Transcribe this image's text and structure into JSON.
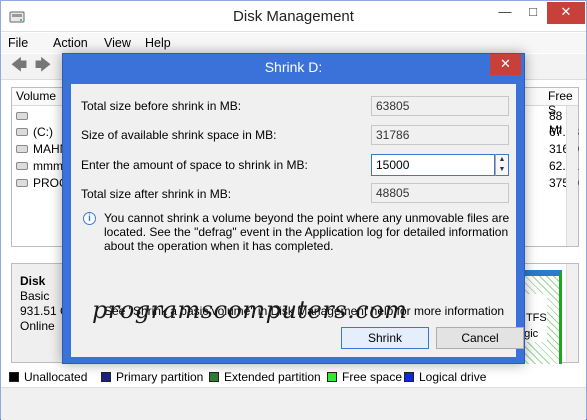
{
  "window": {
    "title": "Disk Management"
  },
  "menu": [
    "File",
    "Action",
    "View",
    "Help"
  ],
  "volume_list": {
    "columns": {
      "volume": "Volume",
      "free": "Free S"
    },
    "rows": [
      {
        "name": "",
        "free": "88 MI"
      },
      {
        "name": "(C:)",
        "free": "67.93"
      },
      {
        "name": "MAHN",
        "free": "316.0"
      },
      {
        "name": "mmm",
        "free": "62.21"
      },
      {
        "name": "PROG",
        "free": "375.0"
      }
    ]
  },
  "disk": {
    "name": "Disk",
    "type": "Basic",
    "size": "931.51 G",
    "status": "Online",
    "bar_lines": [
      ":)",
      "NTFS",
      "ogic"
    ]
  },
  "legend": [
    {
      "label": "Unallocated",
      "color": "#000000"
    },
    {
      "label": "Primary partition",
      "color": "#1a237e"
    },
    {
      "label": "Extended partition",
      "color": "#2e7d32"
    },
    {
      "label": "Free space",
      "color": "#39e639"
    },
    {
      "label": "Logical drive",
      "color": "#0b2bdc"
    }
  ],
  "dialog": {
    "title": "Shrink D:",
    "fields": [
      {
        "label": "Total size before shrink in MB:",
        "value": "63805"
      },
      {
        "label": "Size of available shrink space in MB:",
        "value": "31786"
      },
      {
        "label": "Enter the amount of space to shrink in MB:",
        "value": "15000"
      },
      {
        "label": "Total size after shrink in MB:",
        "value": "48805"
      }
    ],
    "info": "You cannot shrink a volume beyond the point where any unmovable files are located. See the \"defrag\" event in the Application log for detailed information about the operation when it has completed.",
    "help": "See \"Shrink a basic volume\" in Disk Management help for more information",
    "buttons": {
      "shrink": "Shrink",
      "cancel": "Cancel"
    }
  },
  "watermark": "programscomputers.com"
}
